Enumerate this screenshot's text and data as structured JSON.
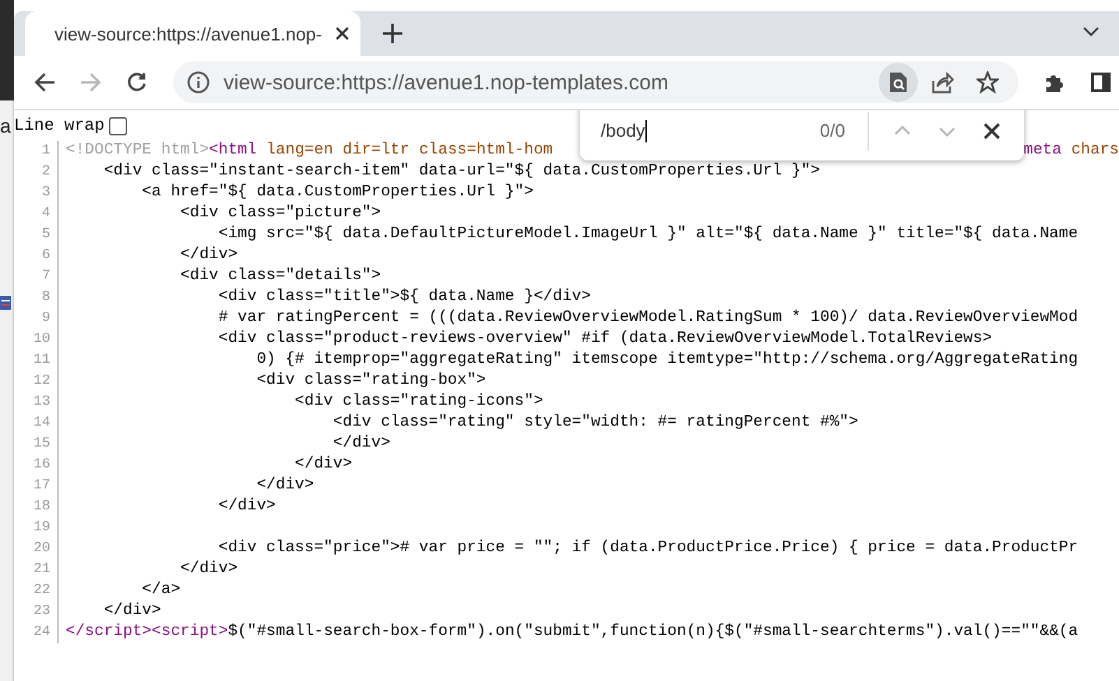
{
  "desktop": {
    "fragment": "a"
  },
  "tab": {
    "title": "view-source:https://avenue1.nop-",
    "selected": true
  },
  "nav": [
    {
      "kind": "back",
      "disabled": false
    },
    {
      "kind": "forward",
      "disabled": true
    },
    {
      "kind": "reload",
      "disabled": false
    }
  ],
  "address": {
    "url": "view-source:https://avenue1.nop-templates.com"
  },
  "address_actions": [
    {
      "kind": "find",
      "selected": true
    },
    {
      "kind": "share",
      "selected": false
    },
    {
      "kind": "star",
      "selected": false
    }
  ],
  "find_bar": {
    "value": "/body",
    "count": "0/0",
    "buttons": [
      {
        "kind": "up",
        "disabled": true
      },
      {
        "kind": "down",
        "disabled": true
      },
      {
        "kind": "close",
        "disabled": false
      }
    ]
  },
  "line_wrap": {
    "label": "Line wrap",
    "checked": false
  },
  "lines": [
    {
      "number": "1",
      "tokens": [
        {
          "kind": "doctype",
          "text": "<!DOCTYPE html>"
        },
        {
          "kind": "tag",
          "text": "<html"
        },
        {
          "kind": "attr",
          "text": " lang=en dir=ltr class=html-hom"
        }
      ],
      "tail": [
        {
          "kind": "tag",
          "text": "meta"
        },
        {
          "kind": "attr",
          "text": " chars"
        }
      ]
    },
    {
      "number": "2",
      "tokens": [
        {
          "kind": "text",
          "text": "    <div class=\"instant-search-item\" data-url=\"${ data.CustomProperties.Url }\">"
        }
      ]
    },
    {
      "number": "3",
      "tokens": [
        {
          "kind": "text",
          "text": "        <a href=\"${ data.CustomProperties.Url }\">"
        }
      ]
    },
    {
      "number": "4",
      "tokens": [
        {
          "kind": "text",
          "text": "            <div class=\"picture\">"
        }
      ]
    },
    {
      "number": "5",
      "tokens": [
        {
          "kind": "text",
          "text": "                <img src=\"${ data.DefaultPictureModel.ImageUrl }\" alt=\"${ data.Name }\" title=\"${ data.Name"
        }
      ]
    },
    {
      "number": "6",
      "tokens": [
        {
          "kind": "text",
          "text": "            </div>"
        }
      ]
    },
    {
      "number": "7",
      "tokens": [
        {
          "kind": "text",
          "text": "            <div class=\"details\">"
        }
      ]
    },
    {
      "number": "8",
      "tokens": [
        {
          "kind": "text",
          "text": "                <div class=\"title\">${ data.Name }</div>"
        }
      ]
    },
    {
      "number": "9",
      "tokens": [
        {
          "kind": "text",
          "text": "                # var ratingPercent = (((data.ReviewOverviewModel.RatingSum * 100)/ data.ReviewOverviewMod"
        }
      ]
    },
    {
      "number": "10",
      "tokens": [
        {
          "kind": "text",
          "text": "                <div class=\"product-reviews-overview\" #if (data.ReviewOverviewModel.TotalReviews>"
        }
      ]
    },
    {
      "number": "11",
      "tokens": [
        {
          "kind": "text",
          "text": "                    0) {# itemprop=\"aggregateRating\" itemscope itemtype=\"http://schema.org/AggregateRating"
        }
      ]
    },
    {
      "number": "12",
      "tokens": [
        {
          "kind": "text",
          "text": "                    <div class=\"rating-box\">"
        }
      ]
    },
    {
      "number": "13",
      "tokens": [
        {
          "kind": "text",
          "text": "                        <div class=\"rating-icons\">"
        }
      ]
    },
    {
      "number": "14",
      "tokens": [
        {
          "kind": "text",
          "text": "                            <div class=\"rating\" style=\"width: #= ratingPercent #%\">"
        }
      ]
    },
    {
      "number": "15",
      "tokens": [
        {
          "kind": "text",
          "text": "                            </div>"
        }
      ]
    },
    {
      "number": "16",
      "tokens": [
        {
          "kind": "text",
          "text": "                        </div>"
        }
      ]
    },
    {
      "number": "17",
      "tokens": [
        {
          "kind": "text",
          "text": "                    </div>"
        }
      ]
    },
    {
      "number": "18",
      "tokens": [
        {
          "kind": "text",
          "text": "                </div>"
        }
      ]
    },
    {
      "number": "19"
    },
    {
      "number": "20",
      "tokens": [
        {
          "kind": "text",
          "text": "                <div class=\"price\"># var price = \"\"; if (data.ProductPrice.Price) { price = data.ProductPr"
        }
      ]
    },
    {
      "number": "21",
      "tokens": [
        {
          "kind": "text",
          "text": "            </div>"
        }
      ]
    },
    {
      "number": "22",
      "tokens": [
        {
          "kind": "text",
          "text": "        </a>"
        }
      ]
    },
    {
      "number": "23",
      "tokens": [
        {
          "kind": "text",
          "text": "    </div>"
        }
      ]
    },
    {
      "number": "24",
      "tokens": [
        {
          "kind": "tag",
          "text": "</script><script>"
        },
        {
          "kind": "text",
          "text": "$(\"#small-search-box-form\").on(\"submit\",function(n){$(\"#small-searchterms\").val()==\"\"&&(a"
        }
      ]
    }
  ]
}
